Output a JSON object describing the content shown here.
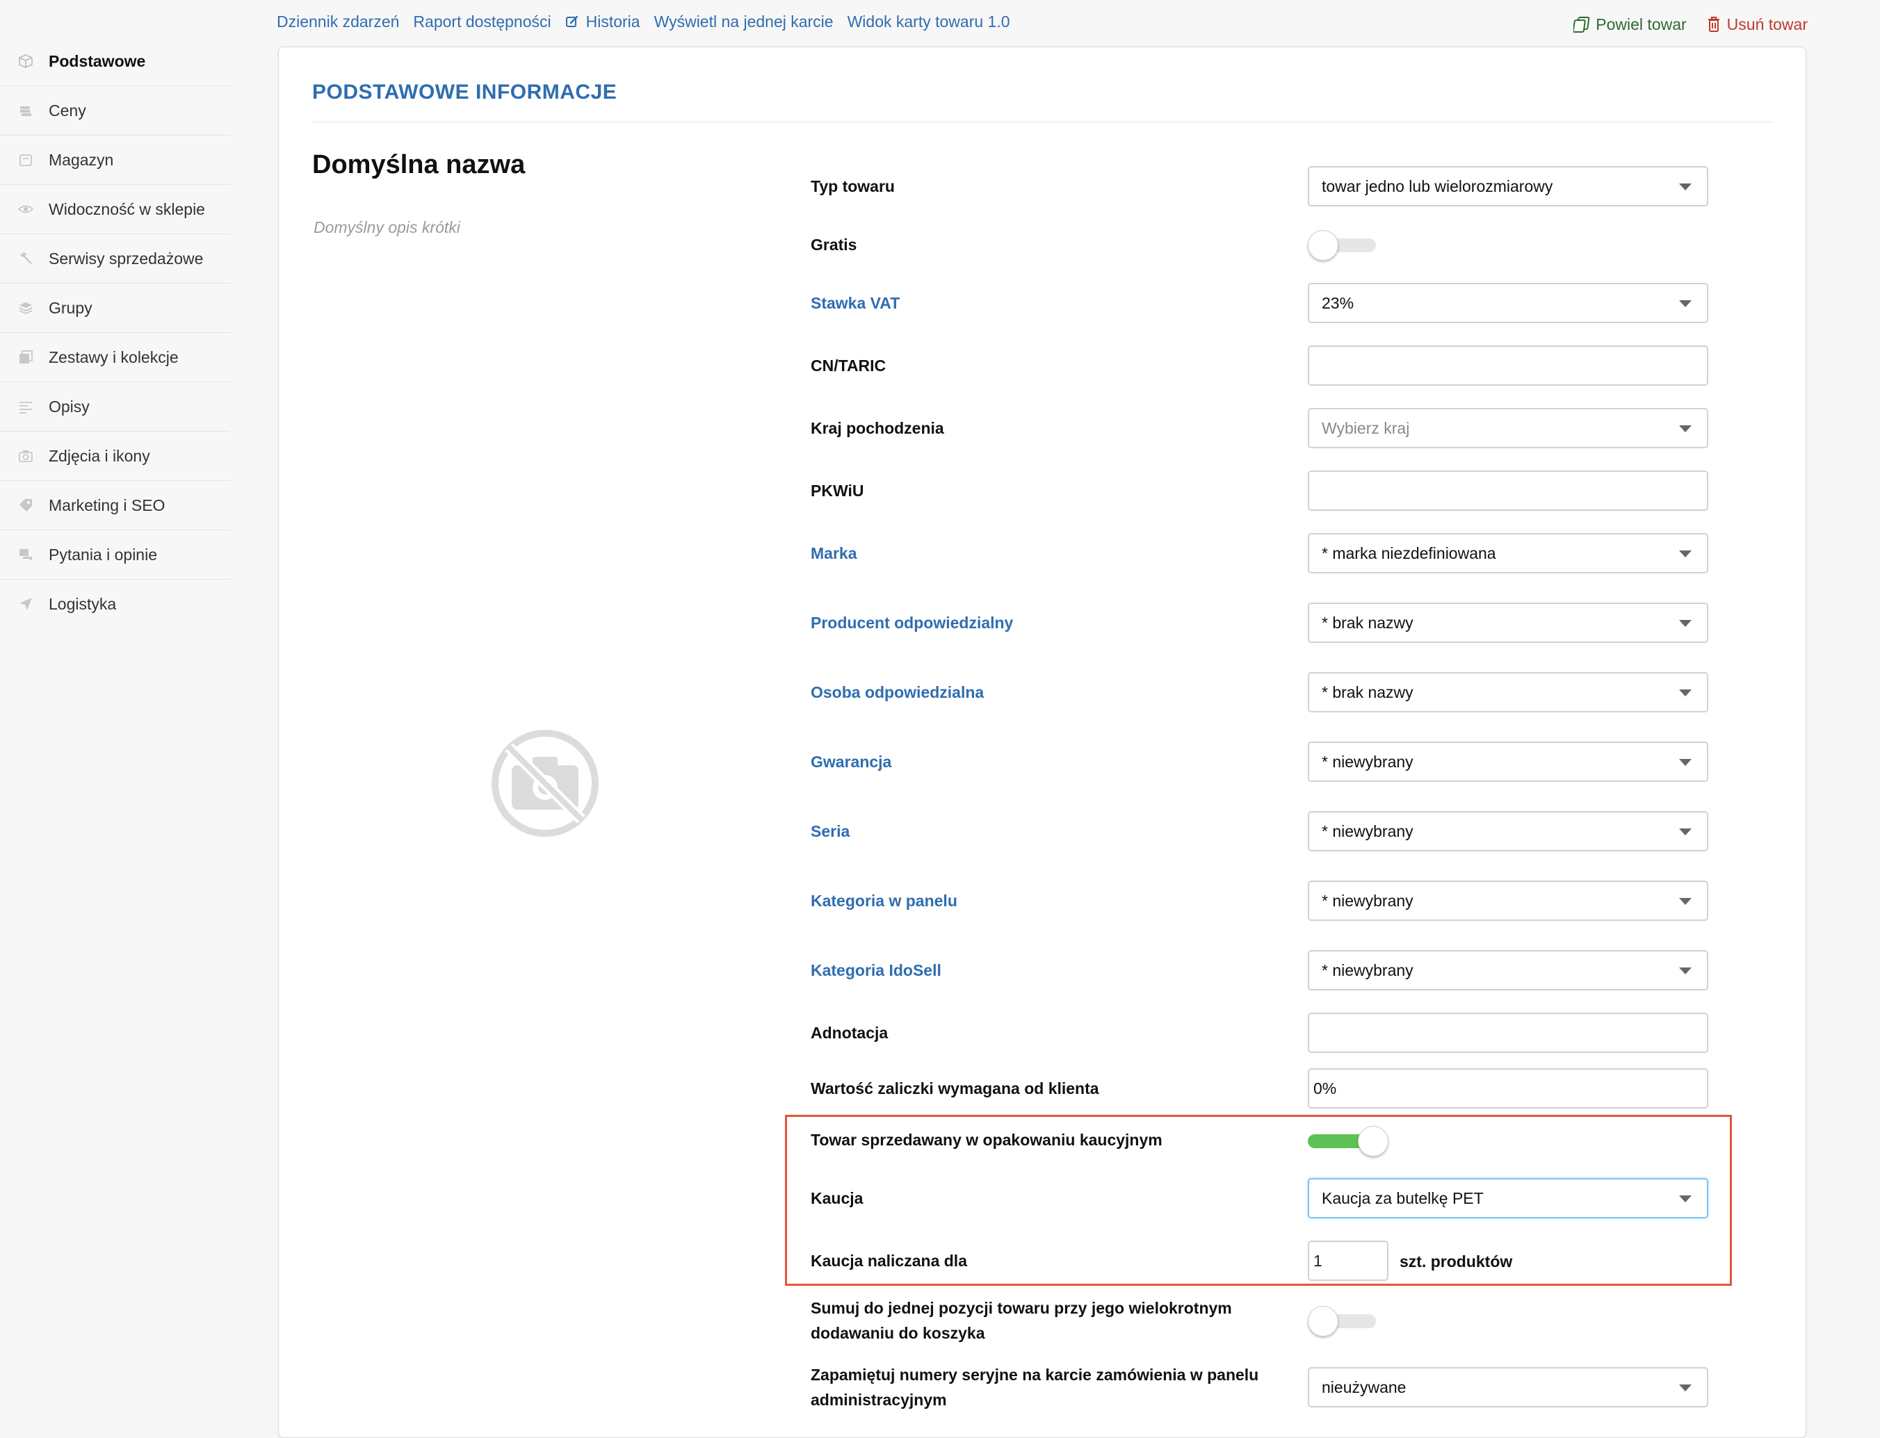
{
  "top_links": [
    "Dziennik zdarzeń",
    "Raport dostępności",
    "Historia",
    "Wyświetl na jednej karcie",
    "Widok karty towaru 1.0"
  ],
  "actions": {
    "duplicate": "Powiel towar",
    "delete": "Usuń towar"
  },
  "sidebar": {
    "items": [
      {
        "label": "Podstawowe",
        "icon": "box-icon"
      },
      {
        "label": "Ceny",
        "icon": "cash-icon"
      },
      {
        "label": "Magazyn",
        "icon": "warehouse-icon"
      },
      {
        "label": "Widoczność w sklepie",
        "icon": "eye-icon"
      },
      {
        "label": "Serwisy sprzedażowe",
        "icon": "hammer-icon"
      },
      {
        "label": "Grupy",
        "icon": "layers-icon"
      },
      {
        "label": "Zestawy i kolekcje",
        "icon": "collection-icon"
      },
      {
        "label": "Opisy",
        "icon": "text-lines-icon"
      },
      {
        "label": "Zdjęcia i ikony",
        "icon": "camera-icon"
      },
      {
        "label": "Marketing i SEO",
        "icon": "tag-icon"
      },
      {
        "label": "Pytania i opinie",
        "icon": "chat-icon"
      },
      {
        "label": "Logistyka",
        "icon": "send-icon"
      }
    ]
  },
  "card": {
    "title": "PODSTAWOWE INFORMACJE",
    "default_name": "Domyślna nazwa",
    "default_desc": "Domyślny opis krótki"
  },
  "form": {
    "typ_towaru": {
      "label": "Typ towaru",
      "value": "towar jedno lub wielorozmiarowy"
    },
    "gratis": {
      "label": "Gratis",
      "on": false
    },
    "stawka_vat": {
      "label": "Stawka VAT",
      "value": "23%"
    },
    "cn_taric": {
      "label": "CN/TARIC",
      "value": ""
    },
    "kraj": {
      "label": "Kraj pochodzenia",
      "placeholder": "Wybierz kraj"
    },
    "pkwiu": {
      "label": "PKWiU",
      "value": ""
    },
    "marka": {
      "label": "Marka",
      "value": "* marka niezdefiniowana"
    },
    "producent": {
      "label": "Producent odpowiedzialny",
      "value": "* brak nazwy"
    },
    "osoba": {
      "label": "Osoba odpowiedzialna",
      "value": "* brak nazwy"
    },
    "gwarancja": {
      "label": "Gwarancja",
      "value": "* niewybrany"
    },
    "seria": {
      "label": "Seria",
      "value": "* niewybrany"
    },
    "kategoria_panel": {
      "label": "Kategoria w panelu",
      "value": "* niewybrany"
    },
    "kategoria_idosell": {
      "label": "Kategoria IdoSell",
      "value": "* niewybrany"
    },
    "adnotacja": {
      "label": "Adnotacja",
      "value": ""
    },
    "zaliczka": {
      "label": "Wartość zaliczki wymagana od klienta",
      "value": "0%"
    },
    "kaucyjny": {
      "label": "Towar sprzedawany w opakowaniu kaucyjnym",
      "on": true
    },
    "kaucja": {
      "label": "Kaucja",
      "value": "Kaucja za butelkę PET"
    },
    "kaucja_dla": {
      "label": "Kaucja naliczana dla",
      "value": "1",
      "unit": "szt. produktów"
    },
    "sumuj": {
      "label_line1": "Sumuj do jednej pozycji towaru przy jego wielokrotnym",
      "label_line2": "dodawaniu do koszyka",
      "on": false
    },
    "seryjne": {
      "label_line1": "Zapamiętuj numery seryjne na karcie zamówienia w panelu",
      "label_line2": "administracyjnym",
      "value": "nieużywane"
    }
  },
  "colors": {
    "accent": "#2f6db0",
    "toggle_on": "#5cc255",
    "highlight": "#e2553a",
    "delete": "#c23a2c",
    "duplicate": "#2c6b34"
  }
}
